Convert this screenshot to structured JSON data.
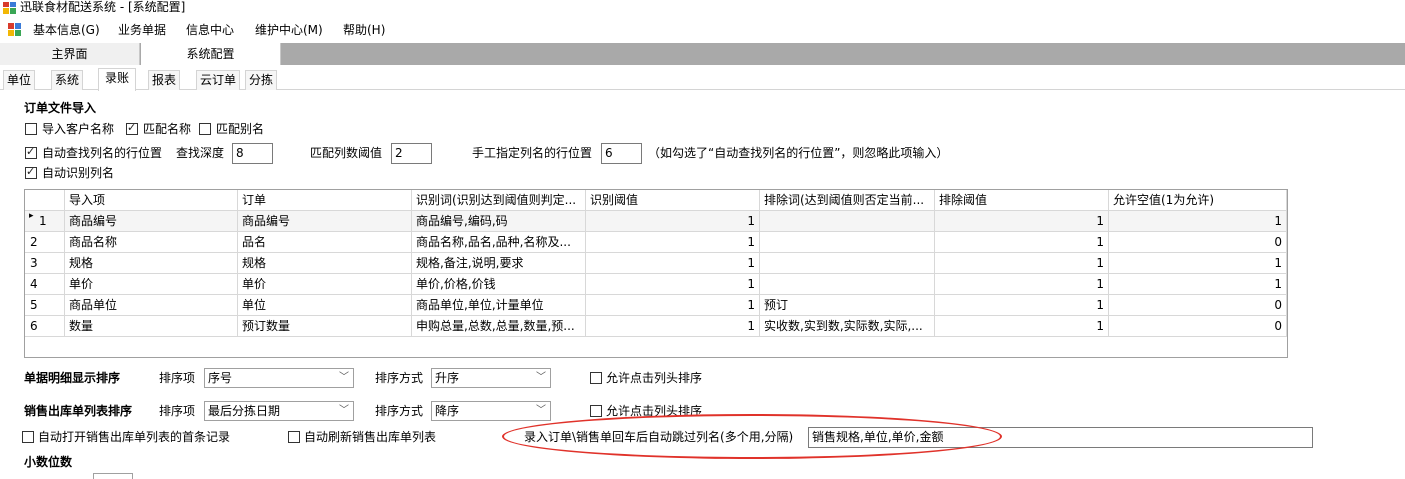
{
  "window": {
    "title": "迅联食材配送系统 - [系统配置]"
  },
  "menu": [
    "基本信息(G)",
    "业务单据",
    "信息中心",
    "维护中心(M)",
    "帮助(H)"
  ],
  "doc_tabs": [
    "主界面",
    "系统配置"
  ],
  "sub_tabs": [
    "单位",
    "系统",
    "录账",
    "报表",
    "云订单",
    "分拣"
  ],
  "import": {
    "section_title": "订单文件导入",
    "import_customer_name": "导入客户名称",
    "match_name": "匹配名称",
    "match_alias": "匹配别名",
    "auto_find_header_row": "自动查找列名的行位置",
    "search_depth_label": "查找深度",
    "search_depth_value": "8",
    "match_threshold_label": "匹配列数阈值",
    "match_threshold_value": "2",
    "manual_row_label": "手工指定列名的行位置",
    "manual_row_value": "6",
    "manual_row_note": "（如勾选了“自动查找列名的行位置”，则忽略此项输入）",
    "auto_identify_columns": "自动识别列名"
  },
  "grid": {
    "columns": [
      "导入项",
      "订单",
      "识别词(识别达到阈值则判定...",
      "识别阈值",
      "排除词(达到阈值则否定当前...",
      "排除阈值",
      "允许空值(1为允许)"
    ],
    "rows": [
      {
        "no": "1",
        "item": "商品编号",
        "order": "商品编号",
        "words": "商品编号,编码,码",
        "th": "1",
        "excl": "",
        "exth": "1",
        "nul": "1"
      },
      {
        "no": "2",
        "item": "商品名称",
        "order": "品名",
        "words": "商品名称,品名,品种,名称及...",
        "th": "1",
        "excl": "",
        "exth": "1",
        "nul": "0"
      },
      {
        "no": "3",
        "item": "规格",
        "order": "规格",
        "words": "规格,备注,说明,要求",
        "th": "1",
        "excl": "",
        "exth": "1",
        "nul": "1"
      },
      {
        "no": "4",
        "item": "单价",
        "order": "单价",
        "words": "单价,价格,价钱",
        "th": "1",
        "excl": "",
        "exth": "1",
        "nul": "1"
      },
      {
        "no": "5",
        "item": "商品单位",
        "order": "单位",
        "words": "商品单位,单位,计量单位",
        "th": "1",
        "excl": "预订",
        "exth": "1",
        "nul": "0"
      },
      {
        "no": "6",
        "item": "数量",
        "order": "预订数量",
        "words": "申购总量,总数,总量,数量,预...",
        "th": "1",
        "excl": "实收数,实到数,实际数,实际,...",
        "exth": "1",
        "nul": "0"
      }
    ]
  },
  "sort_detail": {
    "title": "单据明细显示排序",
    "sort_item_label": "排序项",
    "sort_item_value": "序号",
    "sort_mode_label": "排序方式",
    "sort_mode_value": "升序",
    "allow_header_sort": "允许点击列头排序"
  },
  "sort_sales": {
    "title": "销售出库单列表排序",
    "sort_item_label": "排序项",
    "sort_item_value": "最后分拣日期",
    "sort_mode_label": "排序方式",
    "sort_mode_value": "降序",
    "allow_header_sort": "允许点击列头排序"
  },
  "auto_open_first": "自动打开销售出库单列表的首条记录",
  "auto_refresh": "自动刷新销售出库单列表",
  "skip_columns_label": "录入订单\\销售单回车后自动跳过列名(多个用,分隔)",
  "skip_columns_value": "销售规格,单位,单价,金额",
  "decimal_title": "小数位数",
  "colors": {
    "highlight": "#e0322a",
    "tabstrip": "#a9a9a9"
  }
}
